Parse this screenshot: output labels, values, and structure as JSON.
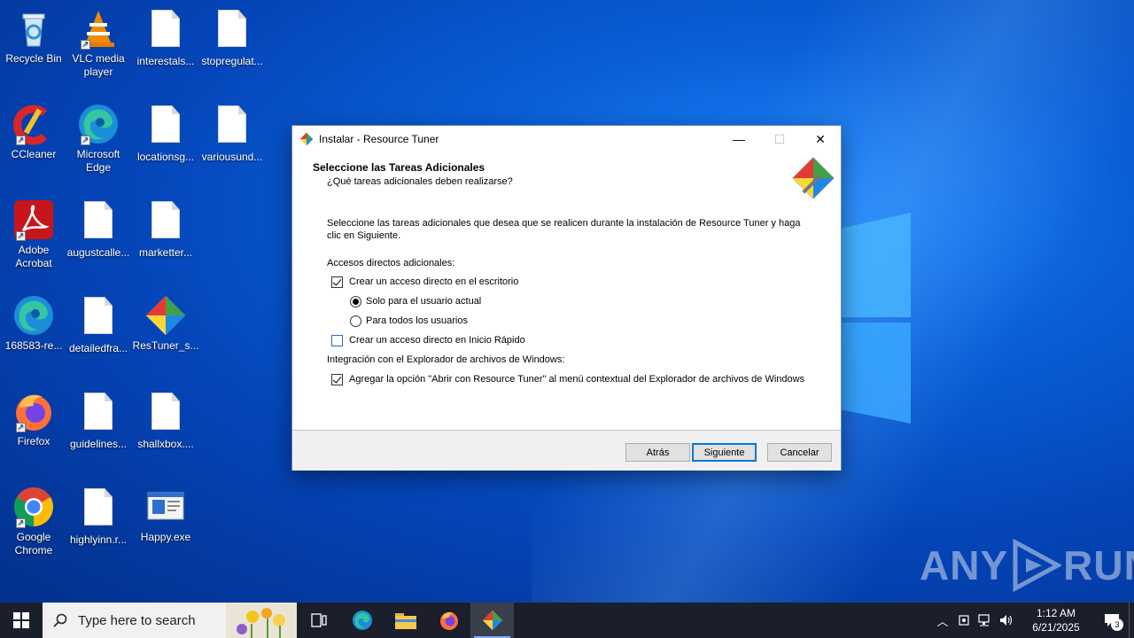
{
  "desktop": {
    "icons": [
      {
        "label": "Recycle Bin",
        "icon": "recycle-bin-icon"
      },
      {
        "label": "VLC media player",
        "icon": "vlc-icon"
      },
      {
        "label": "interestals...",
        "icon": "document-icon"
      },
      {
        "label": "stopregulat...",
        "icon": "document-icon"
      },
      {
        "label": "CCleaner",
        "icon": "ccleaner-icon"
      },
      {
        "label": "Microsoft Edge",
        "icon": "edge-icon"
      },
      {
        "label": "locationsg...",
        "icon": "document-icon"
      },
      {
        "label": "variousund...",
        "icon": "document-icon"
      },
      {
        "label": "Adobe Acrobat",
        "icon": "acrobat-icon"
      },
      {
        "label": "augustcalle...",
        "icon": "document-icon"
      },
      {
        "label": "marketter...",
        "icon": "document-icon"
      },
      {
        "label": "168583-re...",
        "icon": "edge-icon"
      },
      {
        "label": "detailedfra...",
        "icon": "document-icon"
      },
      {
        "label": "ResTuner_s...",
        "icon": "restuner-icon"
      },
      {
        "label": "Firefox",
        "icon": "firefox-icon"
      },
      {
        "label": "guidelines...",
        "icon": "document-icon"
      },
      {
        "label": "shallxbox....",
        "icon": "document-icon"
      },
      {
        "label": "Google Chrome",
        "icon": "chrome-icon"
      },
      {
        "label": "highlyinn.r...",
        "icon": "document-icon"
      },
      {
        "label": "Happy.exe",
        "icon": "exe-icon"
      }
    ]
  },
  "dialog": {
    "title": "Instalar - Resource Tuner",
    "header_title": "Seleccione las Tareas Adicionales",
    "header_subtitle": "¿Qué tareas adicionales deben realizarse?",
    "description": "Seleccione las tareas adicionales que desea que se realicen durante la instalación de Resource Tuner y haga clic en Siguiente.",
    "group1_label": "Accesos directos adicionales:",
    "desktop_shortcut": "Crear un acceso directo en el escritorio",
    "radio_current_user": "Solo para el usuario actual",
    "radio_all_users": "Para todos los usuarios",
    "quicklaunch_shortcut": "Crear un acceso directo en Inicio Rápido",
    "group2_label": "Integración con el Explorador de archivos de Windows:",
    "context_menu": "Agregar la opción \"Abrir con Resource Tuner\" al menú contextual del Explorador de archivos de Windows",
    "buttons": {
      "back": "Atrás",
      "next": "Siguiente",
      "cancel": "Cancelar"
    },
    "window_controls": {
      "minimize": "—",
      "maximize": "☐",
      "close": "✕"
    }
  },
  "watermark": {
    "left": "ANY",
    "right": "RUN"
  },
  "taskbar": {
    "search_placeholder": "Type here to search",
    "time": "1:12 AM",
    "date": "6/21/2025",
    "notification_count": "3"
  },
  "colors": {
    "accent": "#0078d7",
    "taskbar": "#1a1f2b",
    "desktop": "#0a5fd8"
  }
}
